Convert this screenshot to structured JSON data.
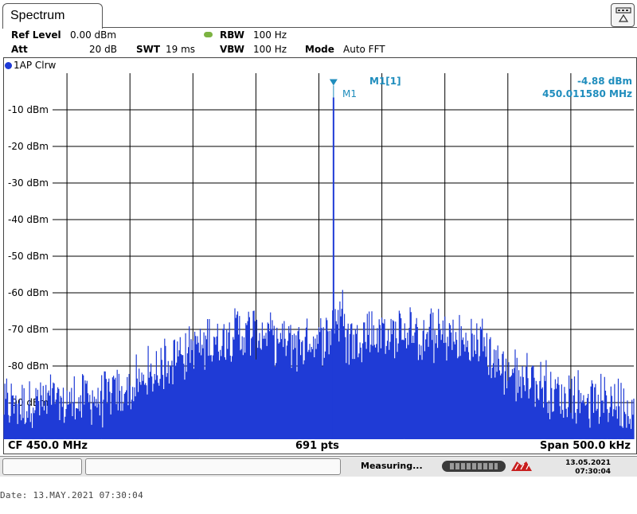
{
  "window": {
    "title": "Spectrum"
  },
  "settings": {
    "ref_level_label": "Ref Level",
    "ref_level_value": "0.00 dBm",
    "att_label": "Att",
    "att_value": "20 dB",
    "swt_label": "SWT",
    "swt_value": "19 ms",
    "rbw_label": "RBW",
    "rbw_value": "100 Hz",
    "vbw_label": "VBW",
    "vbw_value": "100 Hz",
    "mode_label": "Mode",
    "mode_value": "Auto FFT"
  },
  "trace": {
    "label": "1AP Clrw",
    "color": "#1f3bd6"
  },
  "marker": {
    "tag": "M1",
    "id": "M1[1]",
    "level": "-4.88 dBm",
    "frequency": "450.011580 MHz",
    "color": "#1f8dbd"
  },
  "footer": {
    "cf": "CF 450.0 MHz",
    "points": "691 pts",
    "span": "Span 500.0 kHz"
  },
  "status": {
    "text": "Measuring...",
    "progress": 0.85,
    "date": "13.05.2021",
    "time": "07:30:04"
  },
  "date_line": "Date: 13.MAY.2021  07:30:04",
  "chart_data": {
    "type": "line",
    "x_unit": "MHz",
    "xlim": [
      449.75,
      450.25
    ],
    "ylim": [
      -100,
      0
    ],
    "y_ticks": [
      -10,
      -20,
      -30,
      -40,
      -50,
      -60,
      -70,
      -80,
      -90
    ],
    "y_tick_labels": [
      "-10 dBm",
      "-20 dBm",
      "-30 dBm",
      "-40 dBm",
      "-50 dBm",
      "-60 dBm",
      "-70 dBm",
      "-80 dBm",
      "-90 dBm"
    ],
    "grid": true,
    "num_points": 691,
    "series": [
      {
        "color": "#1f3bd6",
        "x": [
          449.75,
          449.8,
          449.85,
          449.87,
          449.9,
          449.93,
          449.96,
          449.98,
          450.0,
          450.01,
          450.0116,
          450.02,
          450.04,
          450.07,
          450.1,
          450.13,
          450.15,
          450.2,
          450.25
        ],
        "y": [
          -99,
          -99,
          -96,
          -90,
          -84,
          -80,
          -80,
          -83,
          -80,
          -83,
          -4.88,
          -82,
          -80,
          -80,
          -81,
          -84,
          -90,
          -98,
          -99
        ]
      }
    ]
  }
}
